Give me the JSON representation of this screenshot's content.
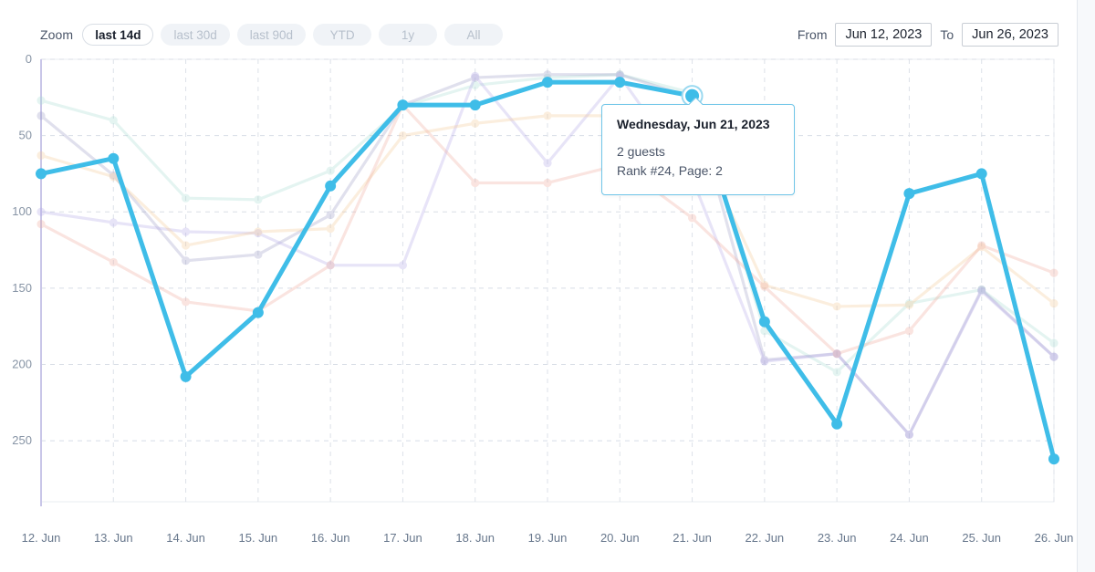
{
  "toolbar": {
    "zoom_label": "Zoom",
    "zoom_buttons": [
      {
        "label": "last 14d",
        "active": true
      },
      {
        "label": "last 30d",
        "active": false
      },
      {
        "label": "last 90d",
        "active": false
      },
      {
        "label": "YTD",
        "active": false
      },
      {
        "label": "1y",
        "active": false
      },
      {
        "label": "All",
        "active": false
      }
    ],
    "from_label": "From",
    "from_value": "Jun 12, 2023",
    "to_label": "To",
    "to_value": "Jun 26, 2023"
  },
  "tooltip": {
    "title": "Wednesday, Jun 21, 2023",
    "line1": "2 guests",
    "line2": "Rank #24, Page: 2"
  },
  "chart_data": {
    "type": "line",
    "title": "",
    "xlabel": "",
    "ylabel": "",
    "grid": true,
    "legend": "none",
    "y_inverted": true,
    "ylim": [
      0,
      290
    ],
    "yticks": [
      0,
      50,
      100,
      150,
      200,
      250
    ],
    "ytick_labels": [
      "0",
      "50",
      "100",
      "150",
      "200",
      "250"
    ],
    "x": [
      "12. Jun",
      "13. Jun",
      "14. Jun",
      "15. Jun",
      "16. Jun",
      "17. Jun",
      "18. Jun",
      "19. Jun",
      "20. Jun",
      "21. Jun",
      "22. Jun",
      "23. Jun",
      "24. Jun",
      "25. Jun",
      "26. Jun"
    ],
    "highlight_series": "2 guests",
    "highlight_point": {
      "x": "21. Jun",
      "value": 24
    },
    "series": [
      {
        "name": "2 guests",
        "color": "#3fbde8",
        "highlighted": true,
        "values": [
          75,
          65,
          208,
          166,
          83,
          30,
          30,
          15,
          15,
          24,
          172,
          239,
          88,
          75,
          262
        ]
      },
      {
        "name": "series-teal",
        "color": "#a8ded2",
        "highlighted": false,
        "values": [
          27,
          40,
          91,
          92,
          73,
          31,
          17,
          12,
          10,
          22,
          178,
          205,
          160,
          151,
          186
        ]
      },
      {
        "name": "series-slate",
        "color": "#9a9ac4",
        "highlighted": false,
        "values": [
          37,
          76,
          132,
          128,
          102,
          30,
          12,
          10,
          10,
          25,
          197,
          193,
          246,
          151,
          195
        ]
      },
      {
        "name": "series-lavender",
        "color": "#b3a7e8",
        "highlighted": false,
        "values": [
          100,
          107,
          113,
          114,
          135,
          135,
          11,
          68,
          11,
          78,
          198,
          193,
          246,
          152,
          195
        ]
      },
      {
        "name": "series-amber",
        "color": "#f5c994",
        "highlighted": false,
        "values": [
          63,
          77,
          122,
          113,
          111,
          50,
          42,
          37,
          37,
          45,
          148,
          162,
          161,
          123,
          160
        ]
      },
      {
        "name": "series-salmon",
        "color": "#f0a99b",
        "highlighted": false,
        "values": [
          108,
          133,
          159,
          165,
          135,
          30,
          81,
          81,
          69,
          104,
          149,
          193,
          178,
          122,
          140
        ]
      }
    ]
  }
}
